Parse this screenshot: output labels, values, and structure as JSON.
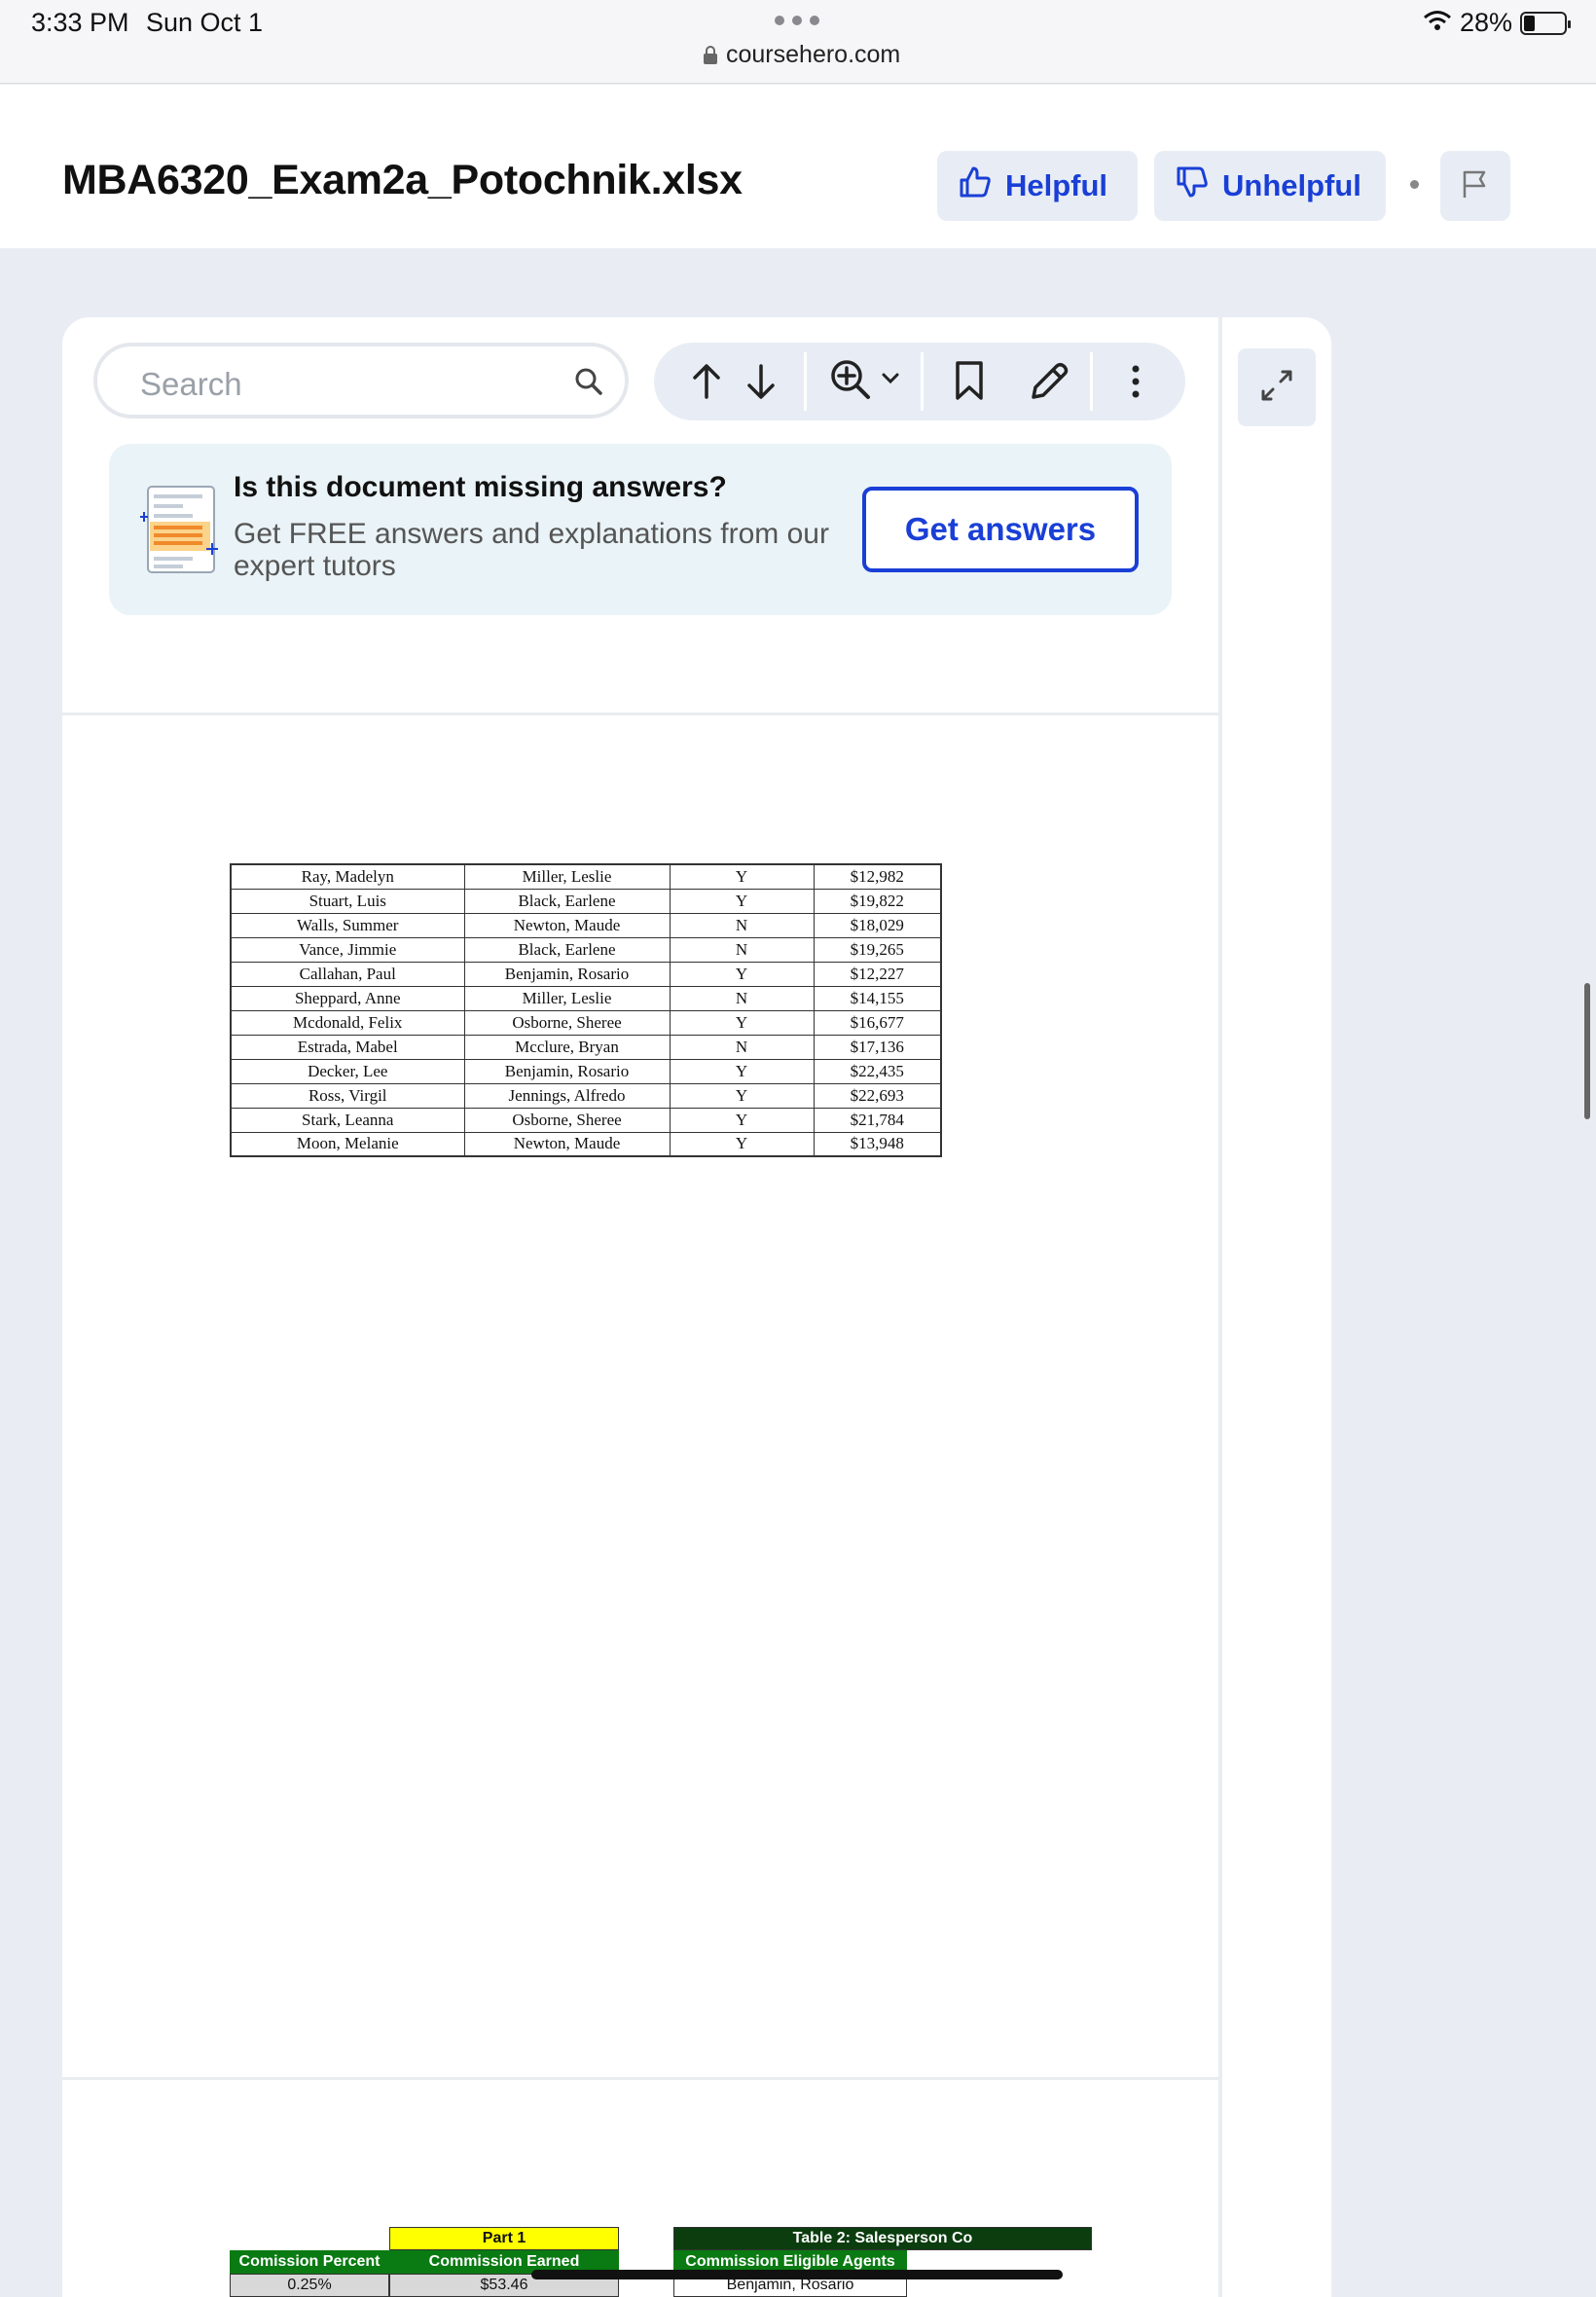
{
  "status_bar": {
    "time": "3:33 PM",
    "date": "Sun Oct 1",
    "url": "coursehero.com",
    "battery": "28%"
  },
  "header": {
    "title": "MBA6320_Exam2a_Potochnik.xlsx",
    "helpful_label": "Helpful",
    "unhelpful_label": "Unhelpful"
  },
  "toolbar": {
    "search_placeholder": "Search"
  },
  "promo": {
    "title": "Is this document missing answers?",
    "text": "Get FREE answers and explanations from our expert tutors",
    "button": "Get answers"
  },
  "table": {
    "rows": [
      [
        "Ray, Madelyn",
        "Miller, Leslie",
        "Y",
        "$12,982"
      ],
      [
        "Stuart, Luis",
        "Black, Earlene",
        "Y",
        "$19,822"
      ],
      [
        "Walls, Summer",
        "Newton, Maude",
        "N",
        "$18,029"
      ],
      [
        "Vance, Jimmie",
        "Black, Earlene",
        "N",
        "$19,265"
      ],
      [
        "Callahan, Paul",
        "Benjamin, Rosario",
        "Y",
        "$12,227"
      ],
      [
        "Sheppard, Anne",
        "Miller, Leslie",
        "N",
        "$14,155"
      ],
      [
        "Mcdonald, Felix",
        "Osborne, Sheree",
        "Y",
        "$16,677"
      ],
      [
        "Estrada, Mabel",
        "Mcclure, Bryan",
        "N",
        "$17,136"
      ],
      [
        "Decker, Lee",
        "Benjamin, Rosario",
        "Y",
        "$22,435"
      ],
      [
        "Ross, Virgil",
        "Jennings, Alfredo",
        "Y",
        "$22,693"
      ],
      [
        "Stark, Leanna",
        "Osborne, Sheree",
        "Y",
        "$21,784"
      ],
      [
        "Moon, Melanie",
        "Newton, Maude",
        "Y",
        "$13,948"
      ]
    ]
  },
  "bottom_sheet": {
    "part_label": "Part 1",
    "table2_title": "Table 2: Salesperson Co",
    "col_commission_percent": "Comission Percent",
    "col_commission_earned": "Commission Earned",
    "col_eligible_agents": "Commission Eligible Agents",
    "val_percent": "0.25%",
    "val_earned": "$53.46",
    "val_agent": "Benjamin, Rosario"
  },
  "colors": {
    "accent": "#1a3fd6",
    "header_green": "#0a7a12",
    "dark_green": "#0b3d0e",
    "highlight_yellow": "#ffff00"
  }
}
